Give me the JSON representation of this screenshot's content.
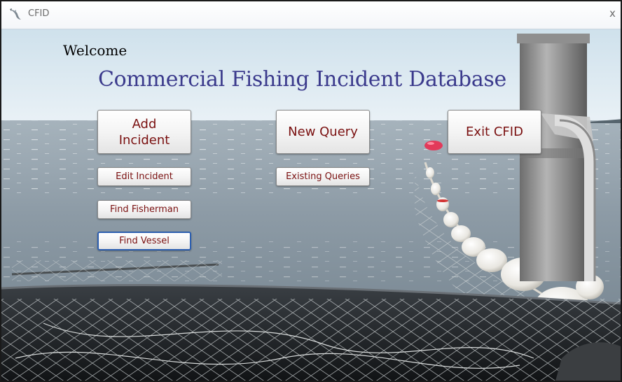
{
  "window": {
    "title": "CFID",
    "close_glyph": "x"
  },
  "welcome_text": "Welcome",
  "main_title": "Commercial Fishing Incident Database",
  "buttons": {
    "add_incident": "Add Incident",
    "new_query": "New Query",
    "exit_cfid": "Exit CFID",
    "edit_incident": "Edit Incident",
    "existing_queries": "Existing Queries",
    "find_fisherman": "Find Fisherman",
    "find_vessel": "Find Vessel"
  },
  "colors": {
    "title_blue": "#3b3a8c",
    "button_text": "#7a1010",
    "sky": "#cfe3ee",
    "water": "#8a9aa6"
  },
  "icons": {
    "app_icon": "fish-icon"
  }
}
